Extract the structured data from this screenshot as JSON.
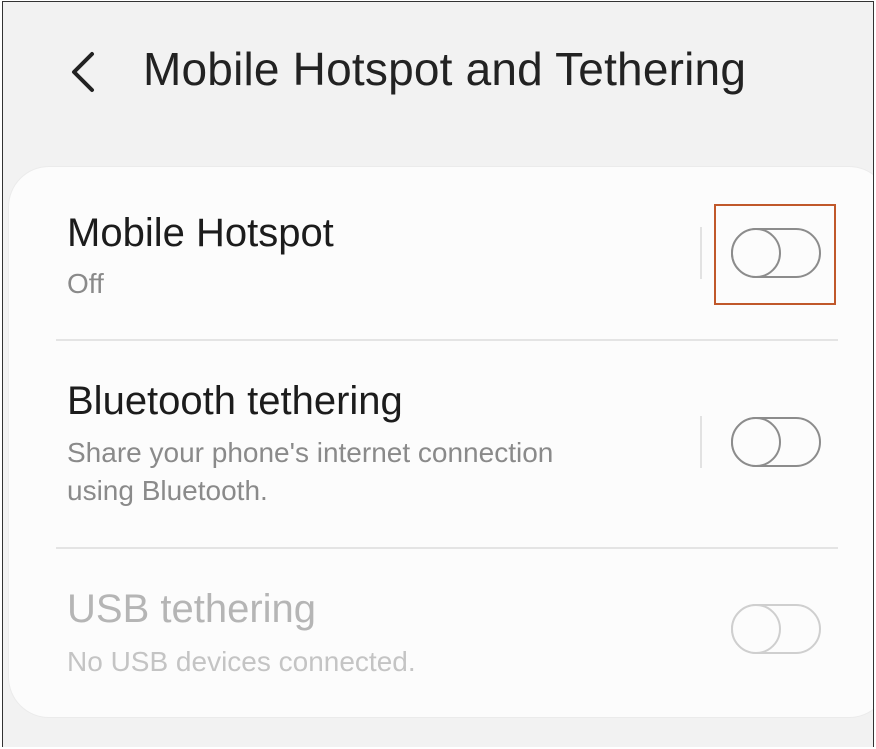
{
  "header": {
    "back_icon": "chevron-left-icon",
    "title": "Mobile Hotspot and Tethering"
  },
  "settings": [
    {
      "title": "Mobile Hotspot",
      "subtitle": "Off",
      "enabled": true,
      "toggle_on": false,
      "highlighted": true
    },
    {
      "title": "Bluetooth tethering",
      "subtitle_lines": [
        "Share your phone's internet connection",
        "using Bluetooth."
      ],
      "enabled": true,
      "toggle_on": false
    },
    {
      "title": "USB tethering",
      "subtitle": "No USB devices connected.",
      "enabled": false,
      "toggle_on": false
    }
  ],
  "colors": {
    "background": "#f2f2f2",
    "card": "#fcfcfc",
    "highlight_box": "#c0582b",
    "toggle_off": "#8c8c8c",
    "disabled_text": "#b5b5b5"
  }
}
